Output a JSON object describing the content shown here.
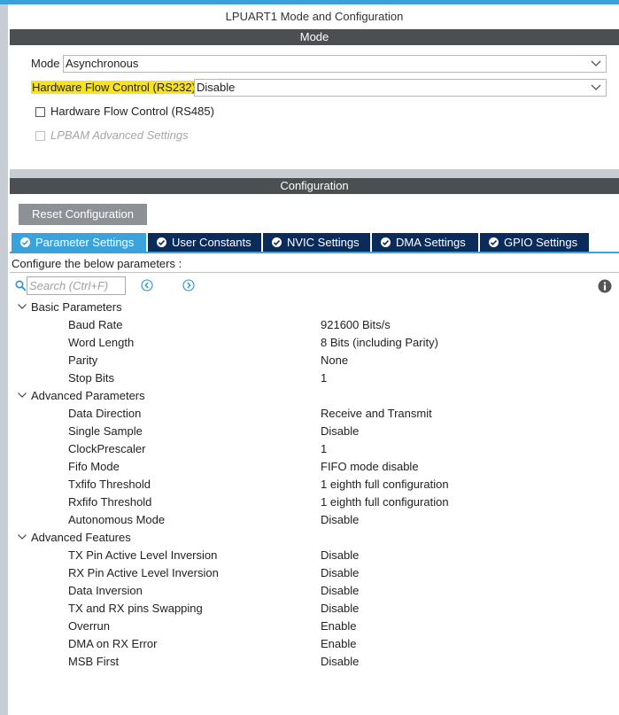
{
  "window": {
    "title": "LPUART1 Mode and Configuration"
  },
  "mode_section": {
    "header": "Mode",
    "mode_label": "Mode",
    "mode_value": "Asynchronous",
    "flow_label": "Hardware Flow Control (RS232)",
    "flow_value": "Disable",
    "rs485_label": "Hardware Flow Control (RS485)",
    "rs485_checked": false,
    "lpbam_label": "LPBAM Advanced Settings",
    "lpbam_checked": false
  },
  "config_section": {
    "header": "Configuration",
    "reset_label": "Reset Configuration",
    "tabs": [
      {
        "label": "Parameter Settings",
        "active": true
      },
      {
        "label": "User Constants",
        "active": false
      },
      {
        "label": "NVIC Settings",
        "active": false
      },
      {
        "label": "DMA Settings",
        "active": false
      },
      {
        "label": "GPIO Settings",
        "active": false
      }
    ],
    "hint": "Configure the below parameters :",
    "search_placeholder": "Search (Ctrl+F)"
  },
  "groups": [
    {
      "name": "Basic Parameters",
      "params": [
        {
          "name": "Baud Rate",
          "value": "921600 Bits/s"
        },
        {
          "name": "Word Length",
          "value": "8 Bits (including Parity)"
        },
        {
          "name": "Parity",
          "value": "None"
        },
        {
          "name": "Stop Bits",
          "value": "1"
        }
      ]
    },
    {
      "name": "Advanced Parameters",
      "params": [
        {
          "name": "Data Direction",
          "value": "Receive and Transmit"
        },
        {
          "name": "Single Sample",
          "value": "Disable"
        },
        {
          "name": "ClockPrescaler",
          "value": "1"
        },
        {
          "name": "Fifo Mode",
          "value": "FIFO mode disable"
        },
        {
          "name": "Txfifo Threshold",
          "value": "1 eighth full configuration"
        },
        {
          "name": "Rxfifo Threshold",
          "value": "1 eighth full configuration"
        },
        {
          "name": "Autonomous Mode",
          "value": "Disable"
        }
      ]
    },
    {
      "name": "Advanced Features",
      "params": [
        {
          "name": "TX Pin Active Level Inversion",
          "value": "Disable"
        },
        {
          "name": "RX Pin Active Level Inversion",
          "value": "Disable"
        },
        {
          "name": "Data Inversion",
          "value": "Disable"
        },
        {
          "name": "TX and RX pins Swapping",
          "value": "Disable"
        },
        {
          "name": "Overrun",
          "value": "Enable"
        },
        {
          "name": "DMA on RX Error",
          "value": "Enable"
        },
        {
          "name": "MSB First",
          "value": "Disable"
        }
      ]
    }
  ],
  "colors": {
    "active_tab": "#3aa3dc",
    "tab": "#0b2b5b",
    "section_bar": "#4b4f52",
    "highlight": "#f7e21b"
  },
  "icons": {
    "search": "search-icon",
    "prev": "chevron-left-circle-icon",
    "next": "chevron-right-circle-icon",
    "info": "info-icon",
    "expand": "chevron-down-icon",
    "tab_status": "check-circle-icon"
  }
}
